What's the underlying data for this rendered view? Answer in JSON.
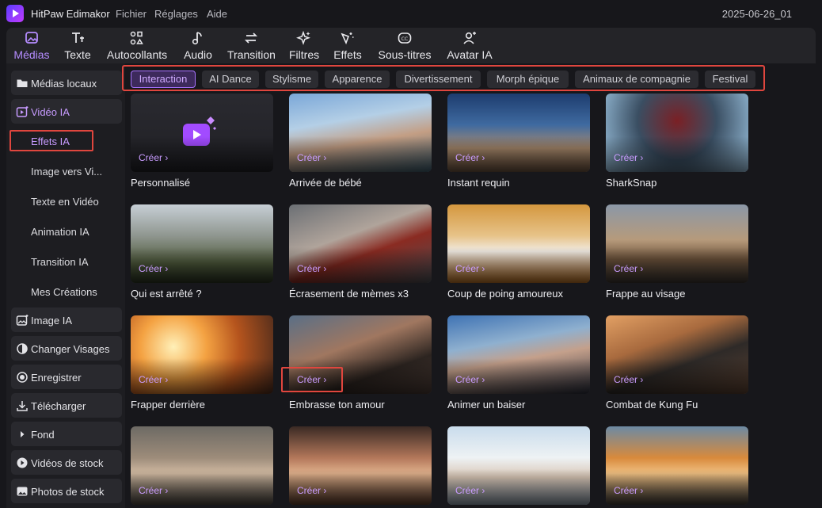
{
  "titlebar": {
    "app_name": "HitPaw Edimakor",
    "menus": [
      "Fichier",
      "Réglages",
      "Aide"
    ],
    "project": "2025-06-26_01"
  },
  "toolbar": {
    "items": [
      {
        "label": "Médias",
        "icon": "media-icon",
        "active": true
      },
      {
        "label": "Texte",
        "icon": "text-icon"
      },
      {
        "label": "Autocollants",
        "icon": "stickers-icon"
      },
      {
        "label": "Audio",
        "icon": "audio-note-icon"
      },
      {
        "label": "Transition",
        "icon": "transition-arrows-icon"
      },
      {
        "label": "Filtres",
        "icon": "sparkle-filter-icon"
      },
      {
        "label": "Effets",
        "icon": "magic-wand-icon"
      },
      {
        "label": "Sous-titres",
        "icon": "subtitles-cc-icon"
      },
      {
        "label": "Avatar IA",
        "icon": "avatar-icon"
      }
    ]
  },
  "sidebar": {
    "items": [
      {
        "label": "Médias locaux",
        "icon": "folder-icon"
      },
      {
        "label": "Vidéo IA",
        "icon": "ai-video-icon",
        "selected": true
      },
      {
        "label": "Image IA",
        "icon": "ai-image-icon"
      },
      {
        "label": "Changer Visages",
        "icon": "face-swap-icon"
      },
      {
        "label": "Enregistrer",
        "icon": "record-icon"
      },
      {
        "label": "Télécharger",
        "icon": "download-icon"
      },
      {
        "label": "Fond",
        "icon": "chevron-right-icon"
      },
      {
        "label": "Vidéos de stock",
        "icon": "stock-video-icon"
      },
      {
        "label": "Photos de stock",
        "icon": "stock-photo-icon"
      }
    ],
    "subitems": [
      {
        "label": "Effets IA",
        "selected": true
      },
      {
        "label": "Image vers Vi..."
      },
      {
        "label": "Texte en Vidéo"
      },
      {
        "label": "Animation IA"
      },
      {
        "label": "Transition IA"
      },
      {
        "label": "Mes Créations"
      }
    ]
  },
  "tabs": [
    {
      "label": "Interaction",
      "selected": true
    },
    {
      "label": "AI Dance"
    },
    {
      "label": "Stylisme"
    },
    {
      "label": "Apparence"
    },
    {
      "label": "Divertissement"
    },
    {
      "label": "Morph épique"
    },
    {
      "label": "Animaux de compagnie"
    },
    {
      "label": "Festival"
    }
  ],
  "create_label": "Créer  ›",
  "cards": [
    {
      "title": "Personnalisé",
      "thumb": "custom-video-icon"
    },
    {
      "title": "Arrivée de bébé",
      "thumb": "family-photo"
    },
    {
      "title": "Instant requin",
      "thumb": "shark-beach"
    },
    {
      "title": "SharkSnap",
      "thumb": "shark-mouth"
    },
    {
      "title": "Qui est arrêté ?",
      "thumb": "arrest-scene"
    },
    {
      "title": "Écrasement de mèmes x3",
      "thumb": "face-squish"
    },
    {
      "title": "Coup de poing amoureux",
      "thumb": "dog-hearts"
    },
    {
      "title": "Frappe au visage",
      "thumb": "face-punch"
    },
    {
      "title": "Frapper derrière",
      "thumb": "explosion-couple"
    },
    {
      "title": "Embrasse ton amour",
      "thumb": "kiss-couple"
    },
    {
      "title": "Animer un baiser",
      "thumb": "kiss-cheek"
    },
    {
      "title": "Combat de Kung Fu",
      "thumb": "kungfu-street"
    },
    {
      "title": "",
      "thumb": "couple-smile"
    },
    {
      "title": "",
      "thumb": "three-friends"
    },
    {
      "title": "",
      "thumb": "polar-bear"
    },
    {
      "title": "",
      "thumb": "tiger-girl"
    }
  ],
  "colors": {
    "accent": "#b58cff",
    "highlight": "#e0463e",
    "panel": "#242428"
  }
}
